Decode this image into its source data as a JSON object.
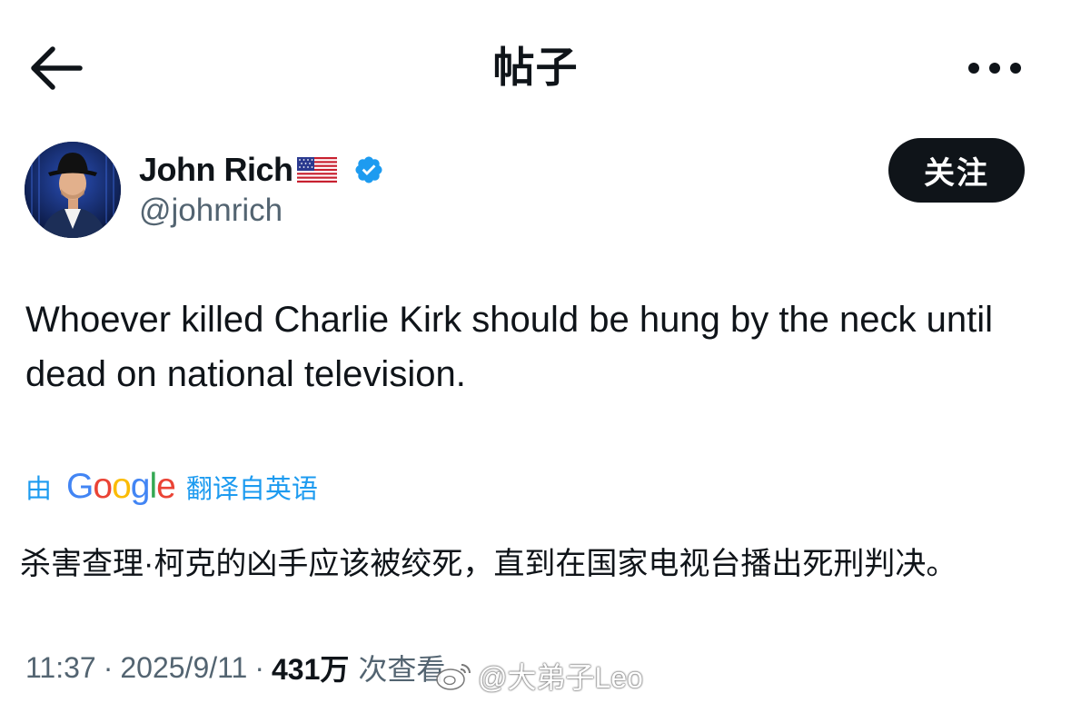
{
  "header": {
    "title": "帖子",
    "back_icon": "arrow-left-icon",
    "more_icon": "more-horizontal-icon"
  },
  "author": {
    "display_name": "John Rich",
    "flag_icon": "us-flag-icon",
    "verified_icon": "verified-badge-icon",
    "verified_color": "#1d9bf0",
    "handle": "@johnrich",
    "follow_label": "关注"
  },
  "tweet": {
    "text": "Whoever killed Charlie Kirk should be hung by the neck until dead on national television."
  },
  "translation": {
    "by_label": "由",
    "provider": "Google",
    "link_label": "翻译自英语",
    "text": "杀害查理·柯克的凶手应该被绞死，直到在国家电视台播出死刑判决。"
  },
  "meta": {
    "time": "11:37",
    "separator": "·",
    "date": "2025/9/11",
    "view_count": "431万",
    "views_label": "次查看"
  },
  "watermark": {
    "icon": "weibo-icon",
    "text": "@大弟子Leo"
  },
  "colors": {
    "text_primary": "#0f1419",
    "text_secondary": "#536471",
    "accent": "#1d9bf0",
    "follow_button_bg": "#0f1419"
  }
}
